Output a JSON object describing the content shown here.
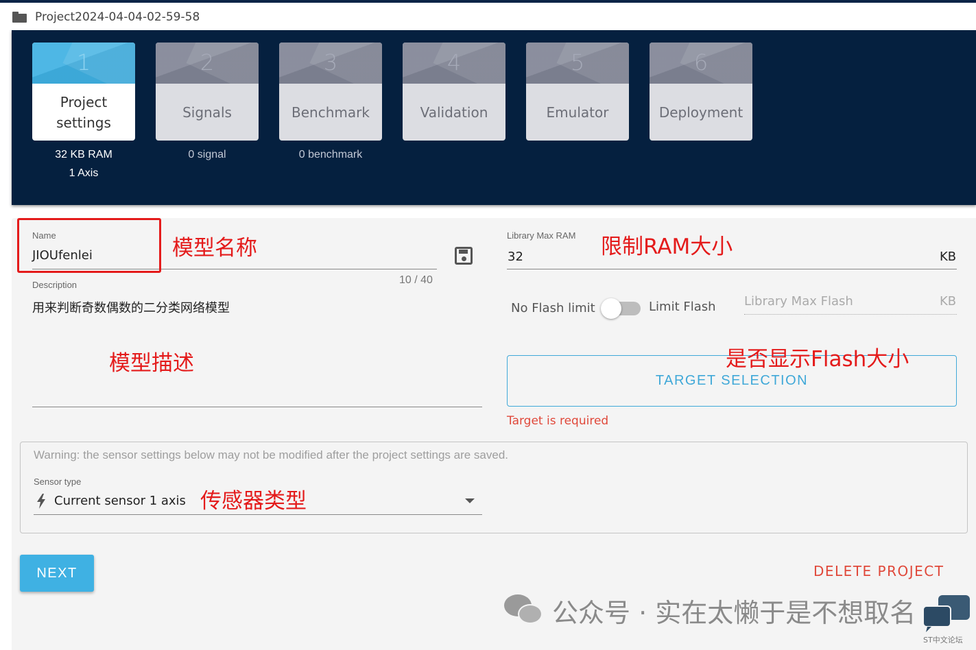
{
  "project": {
    "title": "Project2024-04-04-02-59-58"
  },
  "steps": [
    {
      "num": "1",
      "label": "Project settings",
      "sub": [
        "32 KB RAM",
        "1 Axis"
      ],
      "active": true
    },
    {
      "num": "2",
      "label": "Signals",
      "sub": [
        "0 signal"
      ],
      "active": false
    },
    {
      "num": "3",
      "label": "Benchmark",
      "sub": [
        "0 benchmark"
      ],
      "active": false
    },
    {
      "num": "4",
      "label": "Validation",
      "sub": [],
      "active": false
    },
    {
      "num": "5",
      "label": "Emulator",
      "sub": [],
      "active": false
    },
    {
      "num": "6",
      "label": "Deployment",
      "sub": [],
      "active": false
    }
  ],
  "form": {
    "name_label": "Name",
    "name_value": "JIOUfenlei",
    "name_counter": "10 / 40",
    "description_label": "Description",
    "description_value": "用来判断奇数偶数的二分类网络模型",
    "ram_label": "Library Max RAM",
    "ram_value": "32",
    "ram_unit": "KB",
    "flash_off_label": "No Flash limit",
    "flash_on_label": "Limit Flash",
    "flash_placeholder": "Library Max Flash",
    "flash_unit": "KB",
    "flash_limit_enabled": false,
    "target_button": "TARGET SELECTION",
    "target_error": "Target is required",
    "warning": "Warning: the sensor settings below may not be modified after the project settings are saved.",
    "sensor_label": "Sensor type",
    "sensor_value": "Current sensor 1 axis",
    "next_button": "NEXT",
    "delete_button": "DELETE PROJECT"
  },
  "annotations": {
    "name": "模型名称",
    "ram": "限制RAM大小",
    "description": "模型描述",
    "flash": "是否显示Flash大小",
    "sensor": "传感器类型"
  },
  "watermark": {
    "text": "公众号 · 实在太懒于是不想取名",
    "st_text": "ST中文论坛"
  },
  "colors": {
    "header_bg": "#05203f",
    "accent": "#3fb1e3",
    "error": "#e0483a",
    "annotation": "#e41b1b"
  }
}
